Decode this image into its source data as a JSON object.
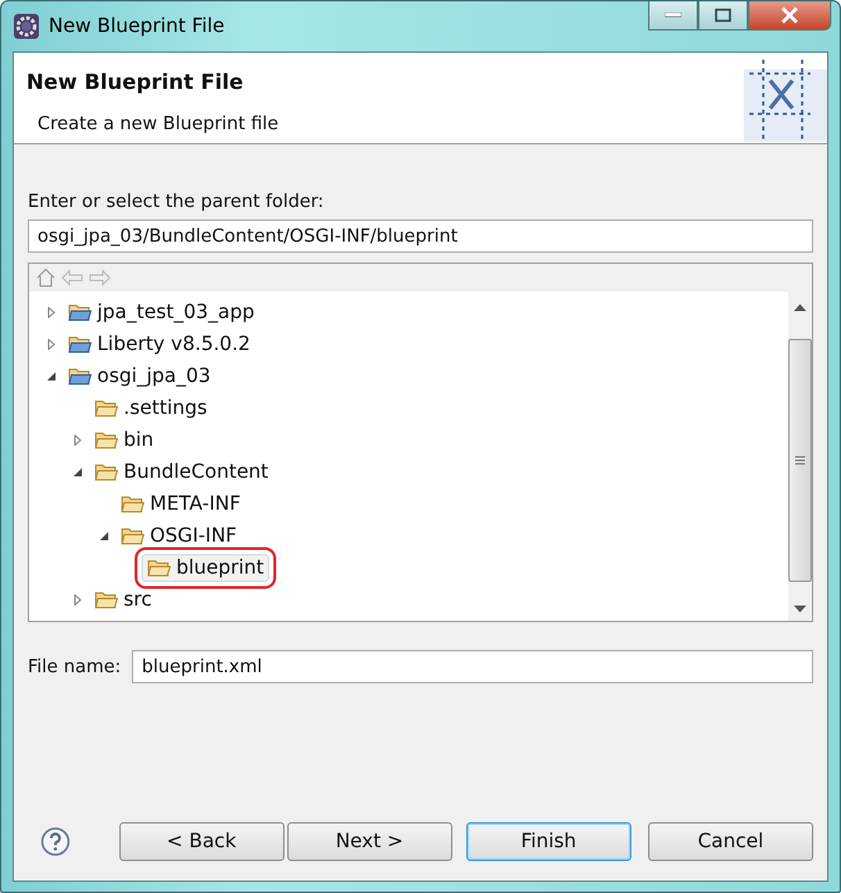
{
  "window": {
    "title": "New Blueprint File"
  },
  "header": {
    "title": "New Blueprint File",
    "description": "Create a new Blueprint file"
  },
  "parent_folder": {
    "label": "Enter or select the parent folder:",
    "value": "osgi_jpa_03/BundleContent/OSGI-INF/blueprint"
  },
  "tree": [
    {
      "label": "jpa_test_03_app",
      "kind": "project",
      "expanded": false,
      "selected": false
    },
    {
      "label": "Liberty v8.5.0.2",
      "kind": "project",
      "expanded": false,
      "selected": false
    },
    {
      "label": "osgi_jpa_03",
      "kind": "project",
      "expanded": true,
      "selected": false,
      "children": [
        {
          "label": ".settings",
          "kind": "folder",
          "selected": false
        },
        {
          "label": "bin",
          "kind": "folder",
          "expanded": false,
          "selected": false
        },
        {
          "label": "BundleContent",
          "kind": "folder",
          "expanded": true,
          "selected": false,
          "children": [
            {
              "label": "META-INF",
              "kind": "folder",
              "selected": false
            },
            {
              "label": "OSGI-INF",
              "kind": "folder",
              "expanded": true,
              "selected": false,
              "children": [
                {
                  "label": "blueprint",
                  "kind": "folder",
                  "selected": true
                }
              ]
            }
          ]
        },
        {
          "label": "src",
          "kind": "folder",
          "expanded": false,
          "selected": false
        }
      ]
    }
  ],
  "file_name": {
    "label": "File name:",
    "value": "blueprint.xml"
  },
  "buttons": [
    {
      "label": "< Back",
      "default": false
    },
    {
      "label": "Next >",
      "default": false
    },
    {
      "label": "Finish",
      "default": true
    },
    {
      "label": "Cancel",
      "default": false
    }
  ]
}
